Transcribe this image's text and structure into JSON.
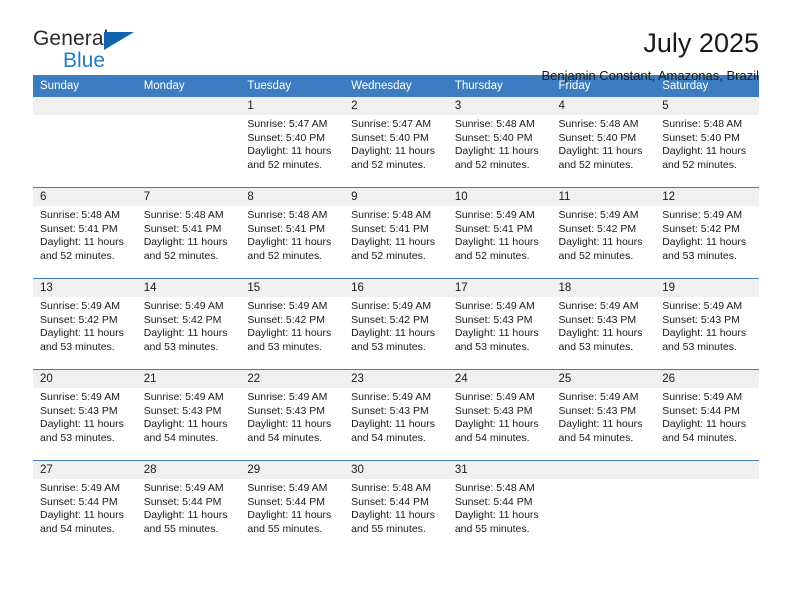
{
  "brand": {
    "name_part1": "General",
    "name_part2": "Blue",
    "triangle_color": "#1263ad",
    "blue_color": "#1f7cc6"
  },
  "header": {
    "title": "July 2025",
    "subtitle": "Benjamin Constant, Amazonas, Brazil"
  },
  "theme": {
    "header_blue": "#3b7dc0",
    "cell_band_gray": "#f0f0f0",
    "text_color": "#1a1a1a"
  },
  "weekday_headers": [
    "Sunday",
    "Monday",
    "Tuesday",
    "Wednesday",
    "Thursday",
    "Friday",
    "Saturday"
  ],
  "weeks": [
    [
      {
        "day": "",
        "lines": []
      },
      {
        "day": "",
        "lines": []
      },
      {
        "day": "1",
        "lines": [
          "Sunrise: 5:47 AM",
          "Sunset: 5:40 PM",
          "Daylight: 11 hours",
          "and 52 minutes."
        ]
      },
      {
        "day": "2",
        "lines": [
          "Sunrise: 5:47 AM",
          "Sunset: 5:40 PM",
          "Daylight: 11 hours",
          "and 52 minutes."
        ]
      },
      {
        "day": "3",
        "lines": [
          "Sunrise: 5:48 AM",
          "Sunset: 5:40 PM",
          "Daylight: 11 hours",
          "and 52 minutes."
        ]
      },
      {
        "day": "4",
        "lines": [
          "Sunrise: 5:48 AM",
          "Sunset: 5:40 PM",
          "Daylight: 11 hours",
          "and 52 minutes."
        ]
      },
      {
        "day": "5",
        "lines": [
          "Sunrise: 5:48 AM",
          "Sunset: 5:40 PM",
          "Daylight: 11 hours",
          "and 52 minutes."
        ]
      }
    ],
    [
      {
        "day": "6",
        "lines": [
          "Sunrise: 5:48 AM",
          "Sunset: 5:41 PM",
          "Daylight: 11 hours",
          "and 52 minutes."
        ]
      },
      {
        "day": "7",
        "lines": [
          "Sunrise: 5:48 AM",
          "Sunset: 5:41 PM",
          "Daylight: 11 hours",
          "and 52 minutes."
        ]
      },
      {
        "day": "8",
        "lines": [
          "Sunrise: 5:48 AM",
          "Sunset: 5:41 PM",
          "Daylight: 11 hours",
          "and 52 minutes."
        ]
      },
      {
        "day": "9",
        "lines": [
          "Sunrise: 5:48 AM",
          "Sunset: 5:41 PM",
          "Daylight: 11 hours",
          "and 52 minutes."
        ]
      },
      {
        "day": "10",
        "lines": [
          "Sunrise: 5:49 AM",
          "Sunset: 5:41 PM",
          "Daylight: 11 hours",
          "and 52 minutes."
        ]
      },
      {
        "day": "11",
        "lines": [
          "Sunrise: 5:49 AM",
          "Sunset: 5:42 PM",
          "Daylight: 11 hours",
          "and 52 minutes."
        ]
      },
      {
        "day": "12",
        "lines": [
          "Sunrise: 5:49 AM",
          "Sunset: 5:42 PM",
          "Daylight: 11 hours",
          "and 53 minutes."
        ]
      }
    ],
    [
      {
        "day": "13",
        "lines": [
          "Sunrise: 5:49 AM",
          "Sunset: 5:42 PM",
          "Daylight: 11 hours",
          "and 53 minutes."
        ]
      },
      {
        "day": "14",
        "lines": [
          "Sunrise: 5:49 AM",
          "Sunset: 5:42 PM",
          "Daylight: 11 hours",
          "and 53 minutes."
        ]
      },
      {
        "day": "15",
        "lines": [
          "Sunrise: 5:49 AM",
          "Sunset: 5:42 PM",
          "Daylight: 11 hours",
          "and 53 minutes."
        ]
      },
      {
        "day": "16",
        "lines": [
          "Sunrise: 5:49 AM",
          "Sunset: 5:42 PM",
          "Daylight: 11 hours",
          "and 53 minutes."
        ]
      },
      {
        "day": "17",
        "lines": [
          "Sunrise: 5:49 AM",
          "Sunset: 5:43 PM",
          "Daylight: 11 hours",
          "and 53 minutes."
        ]
      },
      {
        "day": "18",
        "lines": [
          "Sunrise: 5:49 AM",
          "Sunset: 5:43 PM",
          "Daylight: 11 hours",
          "and 53 minutes."
        ]
      },
      {
        "day": "19",
        "lines": [
          "Sunrise: 5:49 AM",
          "Sunset: 5:43 PM",
          "Daylight: 11 hours",
          "and 53 minutes."
        ]
      }
    ],
    [
      {
        "day": "20",
        "lines": [
          "Sunrise: 5:49 AM",
          "Sunset: 5:43 PM",
          "Daylight: 11 hours",
          "and 53 minutes."
        ]
      },
      {
        "day": "21",
        "lines": [
          "Sunrise: 5:49 AM",
          "Sunset: 5:43 PM",
          "Daylight: 11 hours",
          "and 54 minutes."
        ]
      },
      {
        "day": "22",
        "lines": [
          "Sunrise: 5:49 AM",
          "Sunset: 5:43 PM",
          "Daylight: 11 hours",
          "and 54 minutes."
        ]
      },
      {
        "day": "23",
        "lines": [
          "Sunrise: 5:49 AM",
          "Sunset: 5:43 PM",
          "Daylight: 11 hours",
          "and 54 minutes."
        ]
      },
      {
        "day": "24",
        "lines": [
          "Sunrise: 5:49 AM",
          "Sunset: 5:43 PM",
          "Daylight: 11 hours",
          "and 54 minutes."
        ]
      },
      {
        "day": "25",
        "lines": [
          "Sunrise: 5:49 AM",
          "Sunset: 5:43 PM",
          "Daylight: 11 hours",
          "and 54 minutes."
        ]
      },
      {
        "day": "26",
        "lines": [
          "Sunrise: 5:49 AM",
          "Sunset: 5:44 PM",
          "Daylight: 11 hours",
          "and 54 minutes."
        ]
      }
    ],
    [
      {
        "day": "27",
        "lines": [
          "Sunrise: 5:49 AM",
          "Sunset: 5:44 PM",
          "Daylight: 11 hours",
          "and 54 minutes."
        ]
      },
      {
        "day": "28",
        "lines": [
          "Sunrise: 5:49 AM",
          "Sunset: 5:44 PM",
          "Daylight: 11 hours",
          "and 55 minutes."
        ]
      },
      {
        "day": "29",
        "lines": [
          "Sunrise: 5:49 AM",
          "Sunset: 5:44 PM",
          "Daylight: 11 hours",
          "and 55 minutes."
        ]
      },
      {
        "day": "30",
        "lines": [
          "Sunrise: 5:48 AM",
          "Sunset: 5:44 PM",
          "Daylight: 11 hours",
          "and 55 minutes."
        ]
      },
      {
        "day": "31",
        "lines": [
          "Sunrise: 5:48 AM",
          "Sunset: 5:44 PM",
          "Daylight: 11 hours",
          "and 55 minutes."
        ]
      },
      {
        "day": "",
        "lines": []
      },
      {
        "day": "",
        "lines": []
      }
    ]
  ]
}
